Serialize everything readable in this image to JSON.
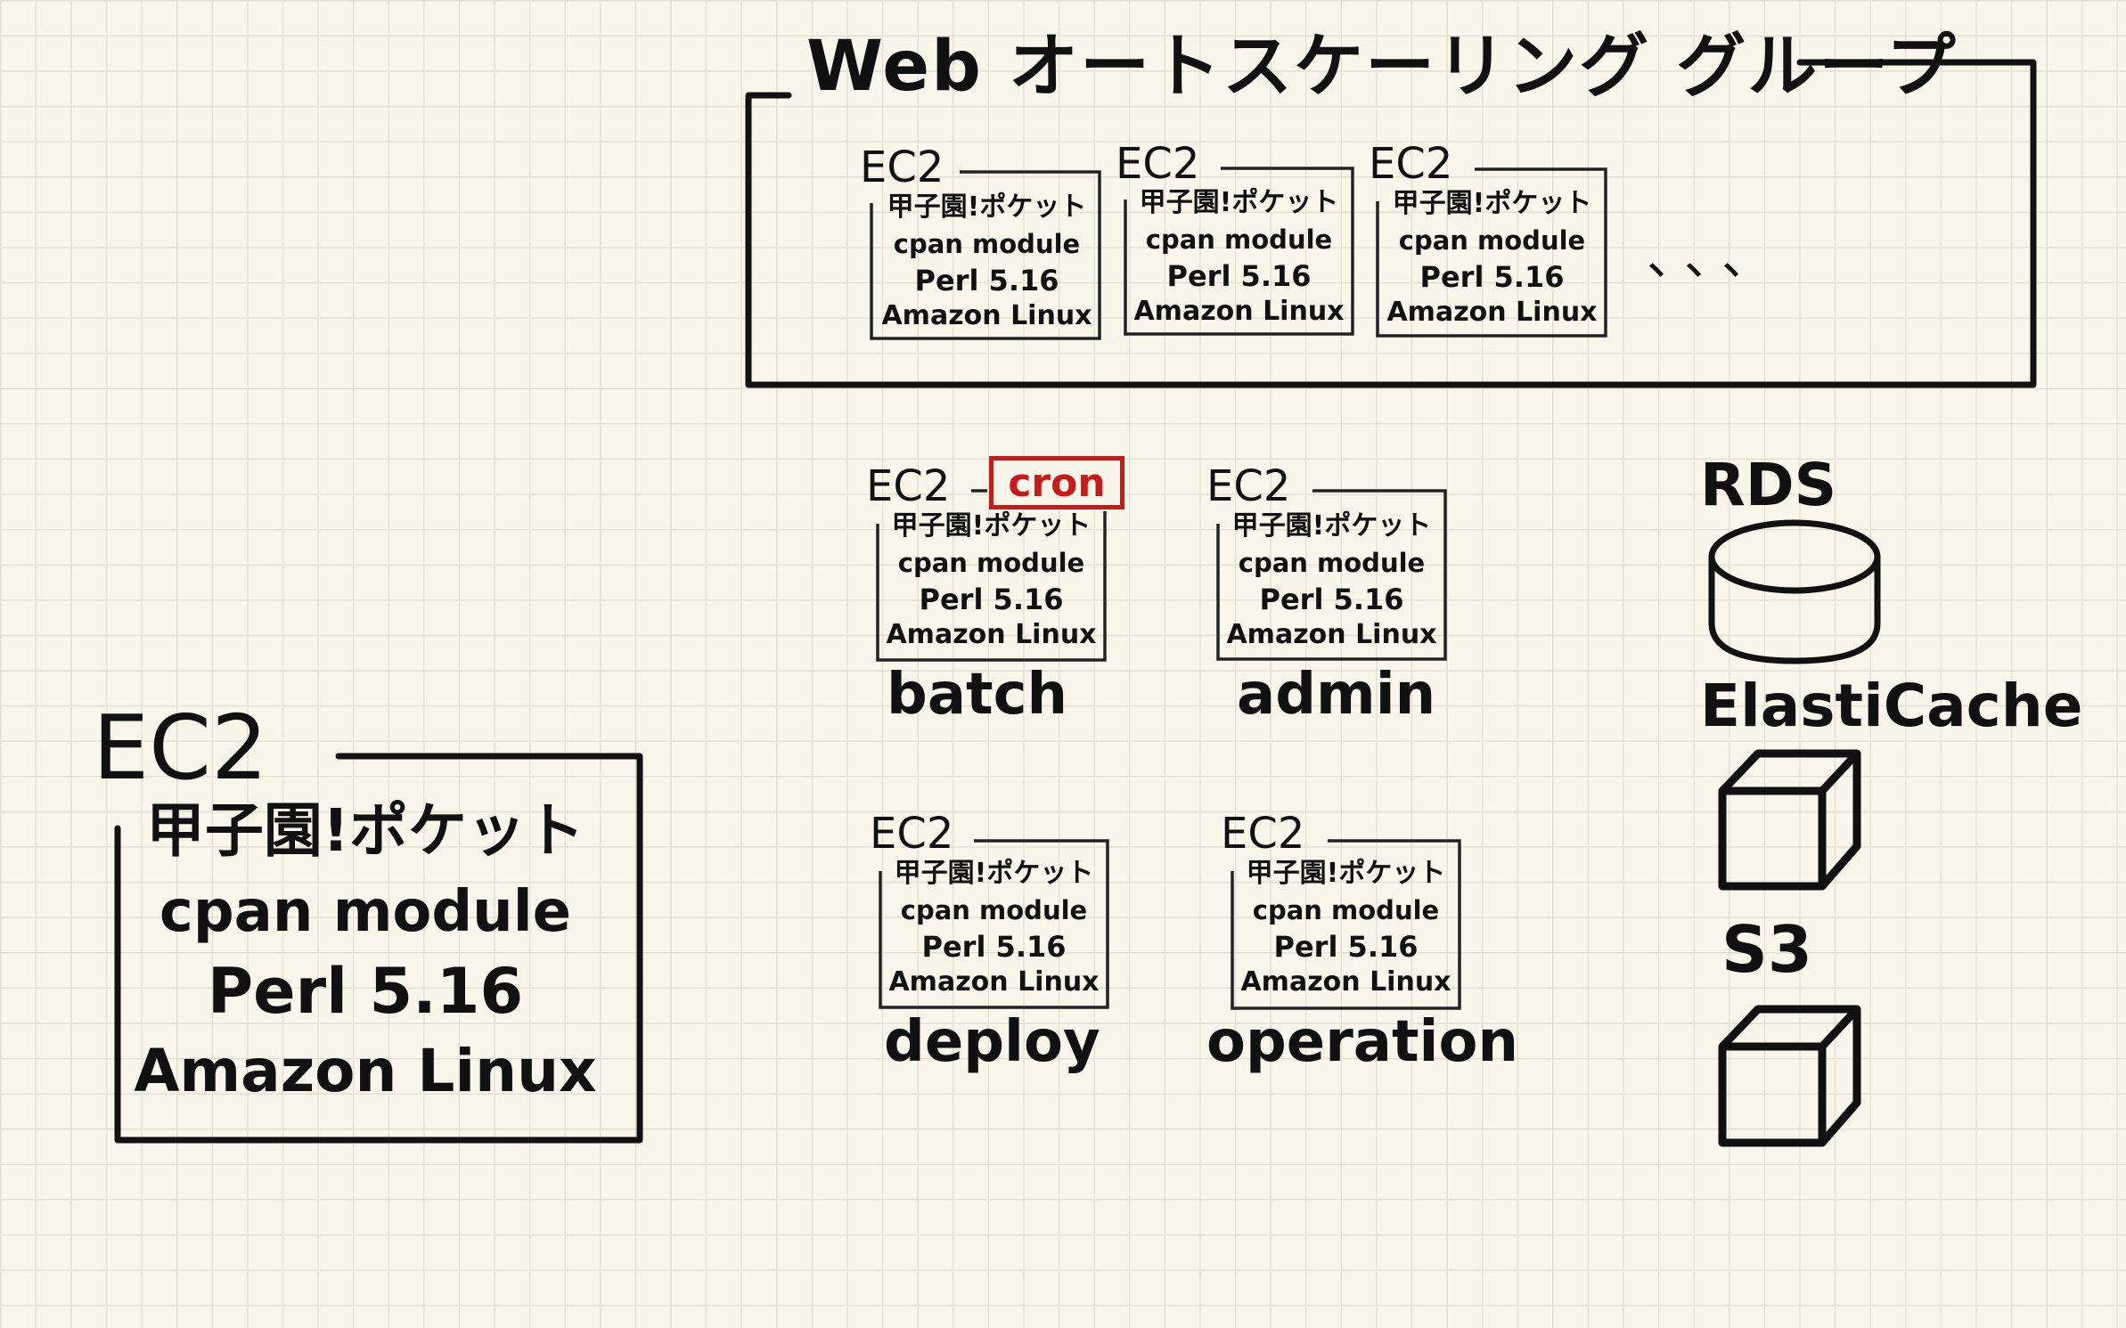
{
  "web_group": {
    "title": "Web オートスケーリング グループ",
    "ellipsis": "、、、"
  },
  "stack_layers": [
    "甲子園!ポケット",
    "cpan module",
    "Perl 5.16",
    "Amazon Linux"
  ],
  "instance_label": "EC2",
  "large_instance": {
    "label": "EC2"
  },
  "web_instances": [
    {
      "label": "EC2"
    },
    {
      "label": "EC2"
    },
    {
      "label": "EC2"
    }
  ],
  "role_instances": [
    {
      "label": "EC2",
      "name": "batch",
      "tag": "cron"
    },
    {
      "label": "EC2",
      "name": "admin"
    },
    {
      "label": "EC2",
      "name": "deploy"
    },
    {
      "label": "EC2",
      "name": "operation"
    }
  ],
  "services": {
    "rds": "RDS",
    "elasticache": "ElastiCache",
    "s3": "S3"
  },
  "colors": {
    "ink": "#111111",
    "cron_red": "#c91a1a",
    "paper": "#f8f6ea"
  }
}
